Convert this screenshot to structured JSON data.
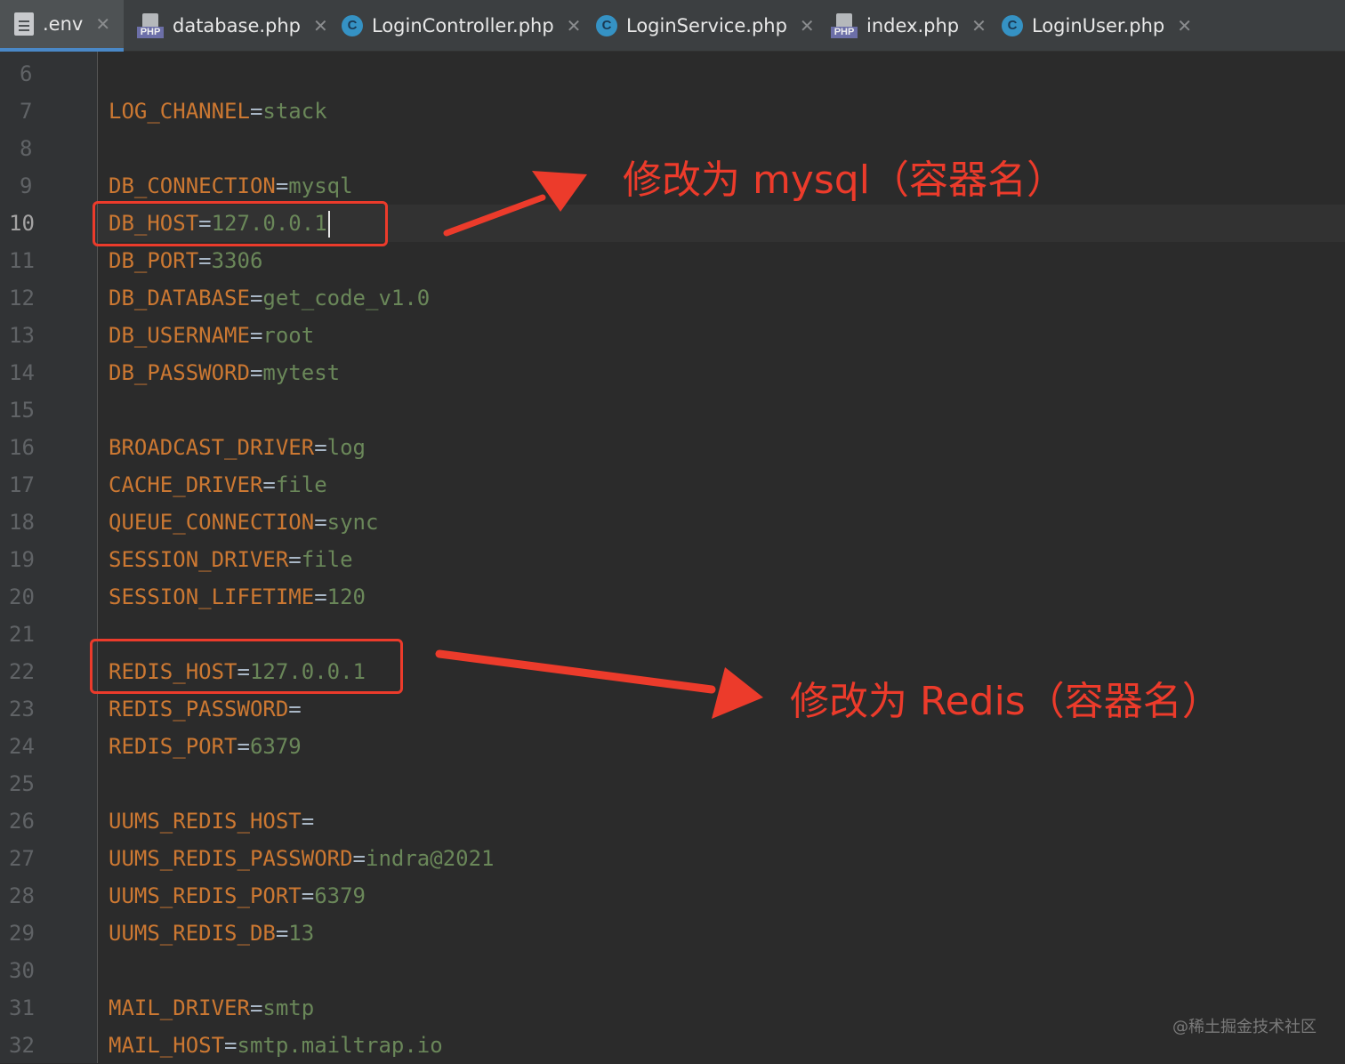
{
  "tabs": [
    {
      "label": ".env",
      "icon": "env-file-icon",
      "active": true
    },
    {
      "label": "database.php",
      "icon": "php-file-icon",
      "active": false
    },
    {
      "label": "LoginController.php",
      "icon": "php-class-icon",
      "active": false
    },
    {
      "label": "LoginService.php",
      "icon": "php-class-icon",
      "active": false
    },
    {
      "label": "index.php",
      "icon": "php-file-icon",
      "active": false
    },
    {
      "label": "LoginUser.php",
      "icon": "php-class-icon",
      "active": false
    }
  ],
  "tab_close_glyph": "✕",
  "php_badge": "PHP",
  "class_badge": "C",
  "current_line": "10",
  "lines": [
    {
      "num": "6",
      "key": "",
      "eq": "",
      "val": ""
    },
    {
      "num": "7",
      "key": "LOG_CHANNEL",
      "eq": "=",
      "val": "stack"
    },
    {
      "num": "8",
      "key": "",
      "eq": "",
      "val": ""
    },
    {
      "num": "9",
      "key": "DB_CONNECTION",
      "eq": "=",
      "val": "mysql"
    },
    {
      "num": "10",
      "key": "DB_HOST",
      "eq": "=",
      "val": "127.0.0.1"
    },
    {
      "num": "11",
      "key": "DB_PORT",
      "eq": "=",
      "val": "3306"
    },
    {
      "num": "12",
      "key": "DB_DATABASE",
      "eq": "=",
      "val": "get_code_v1.0"
    },
    {
      "num": "13",
      "key": "DB_USERNAME",
      "eq": "=",
      "val": "root"
    },
    {
      "num": "14",
      "key": "DB_PASSWORD",
      "eq": "=",
      "val": "mytest"
    },
    {
      "num": "15",
      "key": "",
      "eq": "",
      "val": ""
    },
    {
      "num": "16",
      "key": "BROADCAST_DRIVER",
      "eq": "=",
      "val": "log"
    },
    {
      "num": "17",
      "key": "CACHE_DRIVER",
      "eq": "=",
      "val": "file"
    },
    {
      "num": "18",
      "key": "QUEUE_CONNECTION",
      "eq": "=",
      "val": "sync"
    },
    {
      "num": "19",
      "key": "SESSION_DRIVER",
      "eq": "=",
      "val": "file"
    },
    {
      "num": "20",
      "key": "SESSION_LIFETIME",
      "eq": "=",
      "val": "120"
    },
    {
      "num": "21",
      "key": "",
      "eq": "",
      "val": ""
    },
    {
      "num": "22",
      "key": "REDIS_HOST",
      "eq": "=",
      "val": "127.0.0.1"
    },
    {
      "num": "23",
      "key": "REDIS_PASSWORD",
      "eq": "=",
      "val": ""
    },
    {
      "num": "24",
      "key": "REDIS_PORT",
      "eq": "=",
      "val": "6379"
    },
    {
      "num": "25",
      "key": "",
      "eq": "",
      "val": ""
    },
    {
      "num": "26",
      "key": "UUMS_REDIS_HOST",
      "eq": "=",
      "val": ""
    },
    {
      "num": "27",
      "key": "UUMS_REDIS_PASSWORD",
      "eq": "=",
      "val": "indra@2021"
    },
    {
      "num": "28",
      "key": "UUMS_REDIS_PORT",
      "eq": "=",
      "val": "6379"
    },
    {
      "num": "29",
      "key": "UUMS_REDIS_DB",
      "eq": "=",
      "val": "13"
    },
    {
      "num": "30",
      "key": "",
      "eq": "",
      "val": ""
    },
    {
      "num": "31",
      "key": "MAIL_DRIVER",
      "eq": "=",
      "val": "smtp"
    },
    {
      "num": "32",
      "key": "MAIL_HOST",
      "eq": "=",
      "val": "smtp.mailtrap.io"
    }
  ],
  "annotations": {
    "mysql_note": "修改为 mysql（容器名）",
    "redis_note": "修改为 Redis（容器名）",
    "color": "#ec3b2b"
  },
  "watermark": "@稀土掘金技术社区",
  "colors": {
    "background": "#2b2b2b",
    "key": "#cc7832",
    "value": "#6a8759",
    "operator": "#a9b7c6",
    "line_number": "#606366",
    "active_tab_underline": "#4a88c7"
  }
}
